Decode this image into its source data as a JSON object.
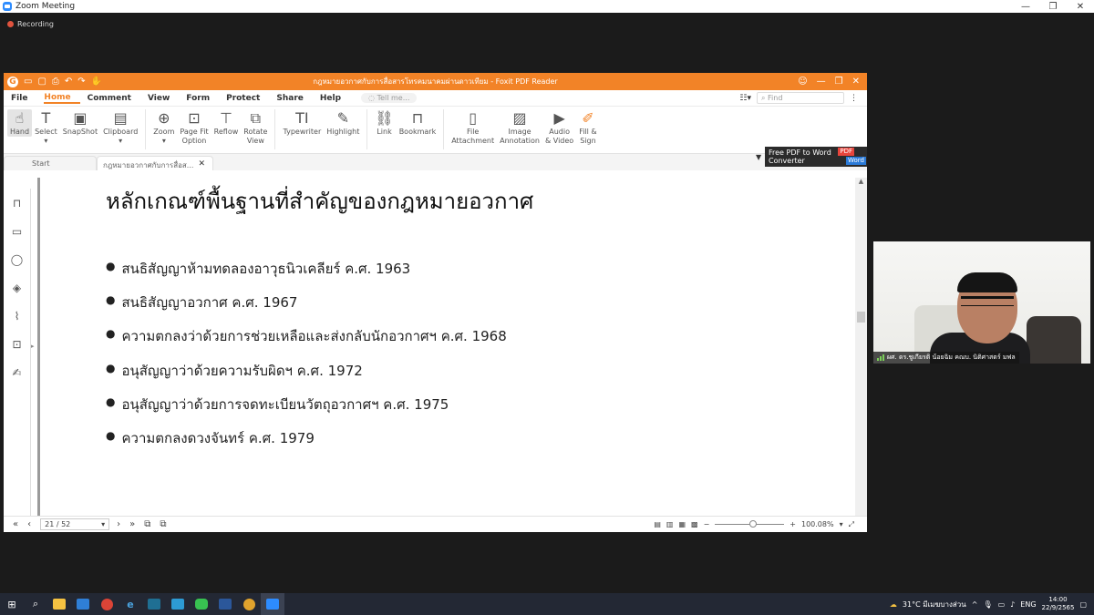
{
  "zoom": {
    "window_title": "Zoom Meeting",
    "recording_label": "Recording",
    "controls": {
      "minimize": "—",
      "restore": "❐",
      "close": "✕"
    }
  },
  "foxit": {
    "window_title": "กฎหมายอวกาศกับการสื่อสารโทรคมนาคมผ่านดาวเทียม - Foxit PDF Reader",
    "menu": [
      "File",
      "Home",
      "Comment",
      "View",
      "Form",
      "Protect",
      "Share",
      "Help"
    ],
    "active_menu": "Home",
    "tell_me_placeholder": "Tell me...",
    "find_placeholder": "Find",
    "ribbon": {
      "hand": "Hand",
      "select": "Select",
      "snapshot": "SnapShot",
      "clipboard": "Clipboard",
      "zoom": "Zoom",
      "page_fit_1": "Page Fit",
      "page_fit_2": "Option",
      "reflow": "Reflow",
      "rotate_1": "Rotate",
      "rotate_2": "View",
      "typewriter": "Typewriter",
      "highlight": "Highlight",
      "link": "Link",
      "bookmark": "Bookmark",
      "file_attach_1": "File",
      "file_attach_2": "Attachment",
      "image_annot_1": "Image",
      "image_annot_2": "Annotation",
      "audio_video_1": "Audio",
      "audio_video_2": "& Video",
      "fill_sign_1": "Fill &",
      "fill_sign_2": "Sign"
    },
    "tabs": {
      "start": "Start",
      "document": "กฎหมายอวกาศกับการสื่อส..."
    },
    "promo": {
      "line1": "Free PDF to Word",
      "line2": "Converter",
      "pdf": "PDF",
      "word": "Word"
    },
    "document": {
      "title": "หลักเกณฑ์พื้นฐานที่สำคัญของกฎหมายอวกาศ",
      "bullets": [
        "สนธิสัญญาห้ามทดลองอาวุธนิวเคลียร์ ค.ศ. 1963",
        "สนธิสัญญาอวกาศ ค.ศ. 1967",
        "ความตกลงว่าด้วยการช่วยเหลือและส่งกลับนักอวกาศฯ ค.ศ. 1968",
        "อนุสัญญาว่าด้วยความรับผิดฯ ค.ศ. 1972",
        "อนุสัญญาว่าด้วยการจดทะเบียนวัตถุอวกาศฯ ค.ศ. 1975",
        "ความตกลงดวงจันทร์ ค.ศ. 1979"
      ]
    },
    "status": {
      "page_indicator": "21 / 52",
      "zoom_level": "100.08%"
    }
  },
  "video": {
    "participant_name": "ผศ. ดร.ชูเกียรติ น้อยฉิม คณบ. นิติศาสตร์ มฟล"
  },
  "taskbar": {
    "weather": "31°C  มีเมฆบางส่วน",
    "language": "ENG",
    "time": "14:00",
    "date": "22/9/2565"
  }
}
